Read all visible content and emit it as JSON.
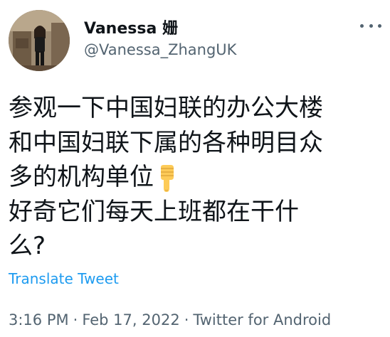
{
  "user": {
    "display_name": "Vanessa 姗",
    "handle": "@Vanessa_ZhangUK",
    "avatar_icon": "profile-photo"
  },
  "more_icon": "more-dots-icon",
  "tweet": {
    "lines": [
      "参观一下中国妇联的办公大楼",
      "和中国妇联下属的各种明目众",
      "多的机构单位",
      "好奇它们每天上班都在干什",
      "么?"
    ],
    "emoji": "point-down-emoji"
  },
  "translate_label": "Translate Tweet",
  "meta": {
    "time": "3:16 PM",
    "separator": "·",
    "date": "Feb 17, 2022",
    "source": "Twitter for Android"
  },
  "colors": {
    "link": "#1d9bf0",
    "secondary": "#536471",
    "text": "#0f1419"
  }
}
